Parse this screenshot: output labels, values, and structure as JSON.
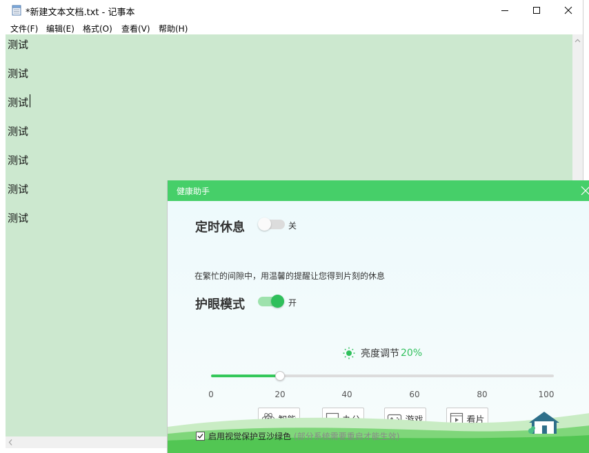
{
  "notepad": {
    "title": "*新建文本文档.txt - 记事本",
    "menu": [
      "文件(F)",
      "编辑(E)",
      "格式(O)",
      "查看(V)",
      "帮助(H)"
    ],
    "lines": [
      "测试",
      "测试",
      "测试",
      "测试",
      "测试",
      "测试",
      "测试"
    ],
    "background_color": "#cce8cf"
  },
  "health_assistant": {
    "title": "健康助手",
    "rest": {
      "title": "定时休息",
      "toggle_label": "关",
      "enabled": false,
      "description": "在繁忙的间隙中，用温馨的提醒让您得到片刻的休息"
    },
    "eye_care": {
      "title": "护眼模式",
      "toggle_label": "开",
      "enabled": true
    },
    "brightness": {
      "label": "亮度调节",
      "value_text": "20%",
      "value": 20,
      "min": 0,
      "max": 100,
      "ticks": [
        "0",
        "20",
        "40",
        "60",
        "80",
        "100"
      ]
    },
    "modes": [
      {
        "label": "智能",
        "icon": "atom-icon"
      },
      {
        "label": "办公",
        "icon": "monitor-icon"
      },
      {
        "label": "游戏",
        "icon": "gamepad-icon"
      },
      {
        "label": "看片",
        "icon": "film-icon"
      }
    ],
    "footer": {
      "checkbox_checked": true,
      "checkbox_label": "启用视觉保护豆沙绿色",
      "note": "(部分系统需要重启才能生效)"
    },
    "accent_color": "#46cf69"
  }
}
